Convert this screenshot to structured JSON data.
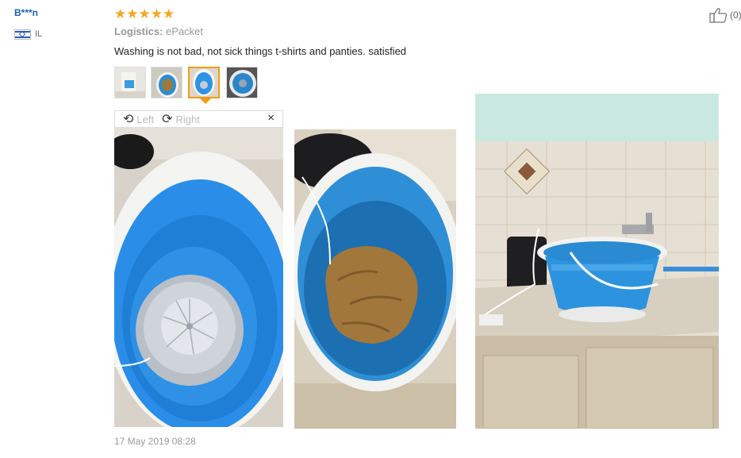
{
  "review": {
    "user_name": "B***n",
    "country": "IL",
    "rating_stars": "★★★★★",
    "rating": 5,
    "logistics_label": "Logistics:",
    "logistics_value": "ePacket",
    "text": "Washing is not bad, not sick things t-shirts and panties. satisfied",
    "helpful_count": "(0)",
    "date": "17 May 2019 08:28"
  },
  "viewer": {
    "rotate_left": "Left",
    "rotate_right": "Right",
    "close": "×"
  },
  "icons": {
    "thumbs_up": "thumbs-up-icon",
    "rotate_left": "rotate-left-icon",
    "rotate_right": "rotate-right-icon",
    "close": "close-icon",
    "flag": "israel-flag-icon"
  },
  "colors": {
    "rating": "#f5a623",
    "active_thumb": "#f39c12",
    "user_link": "#1a5fb4",
    "bucket_blue": "#1e90e0"
  }
}
